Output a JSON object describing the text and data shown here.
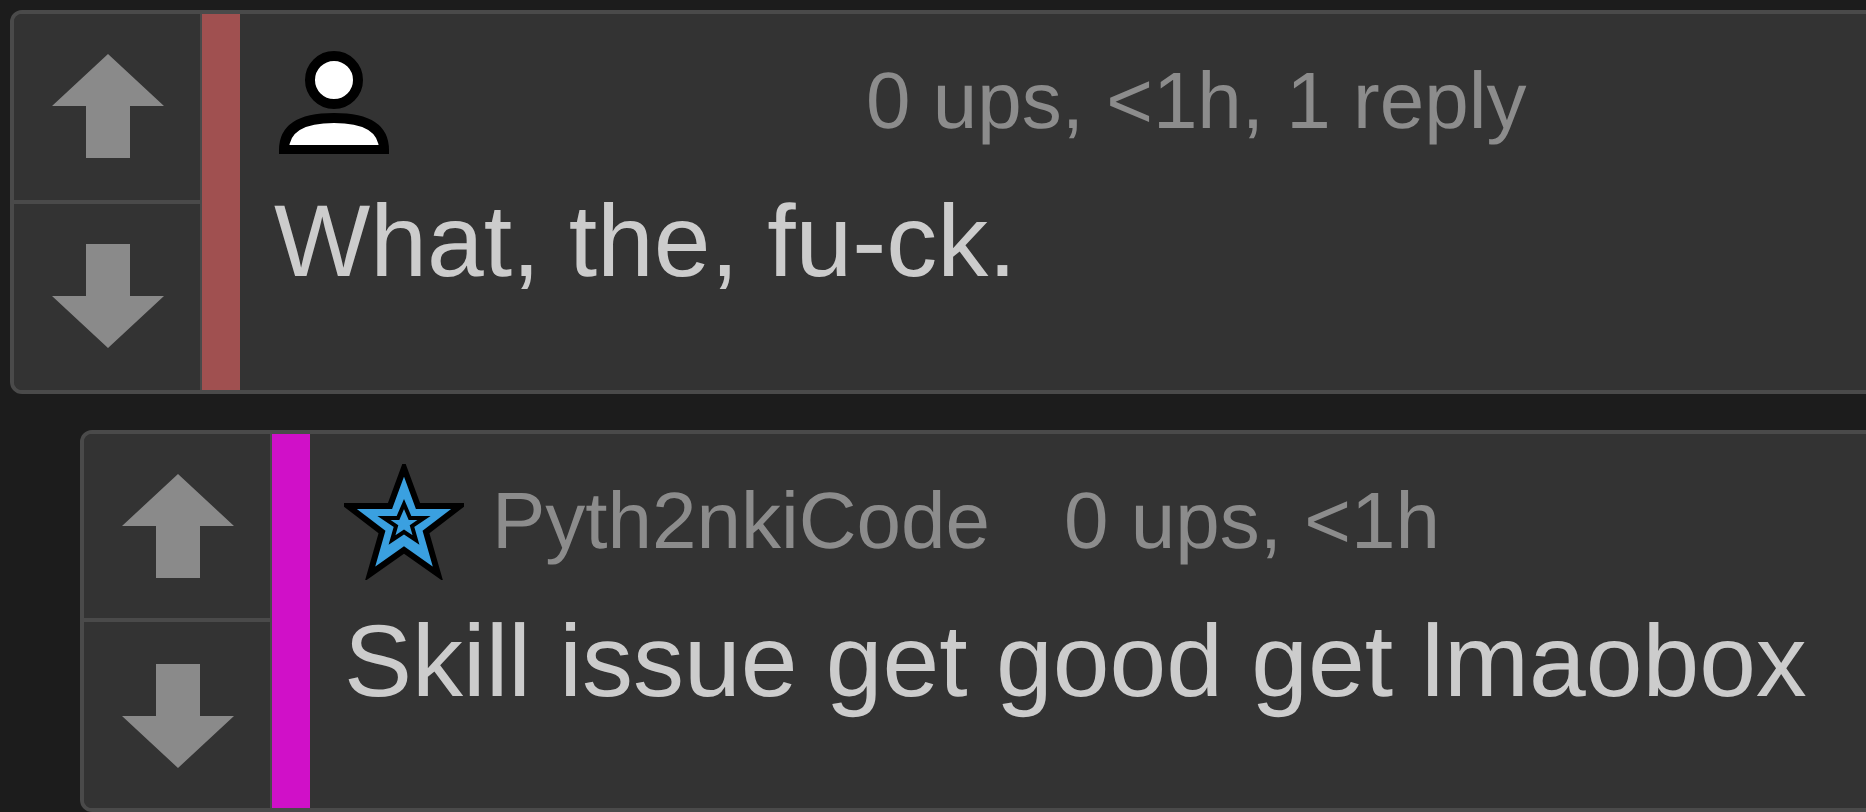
{
  "comments": [
    {
      "avatar": {
        "kind": "silhouette"
      },
      "color": "#a05050",
      "meta": "0 ups, <1h, 1 reply",
      "text": "What, the, fu-ck.",
      "reply": false
    },
    {
      "avatar": {
        "kind": "star"
      },
      "color": "#d010c8",
      "username": "Pyth2nkiCode",
      "meta": "0 ups, <1h",
      "text": "Skill issue get good get lmaobox",
      "reply": true
    }
  ]
}
